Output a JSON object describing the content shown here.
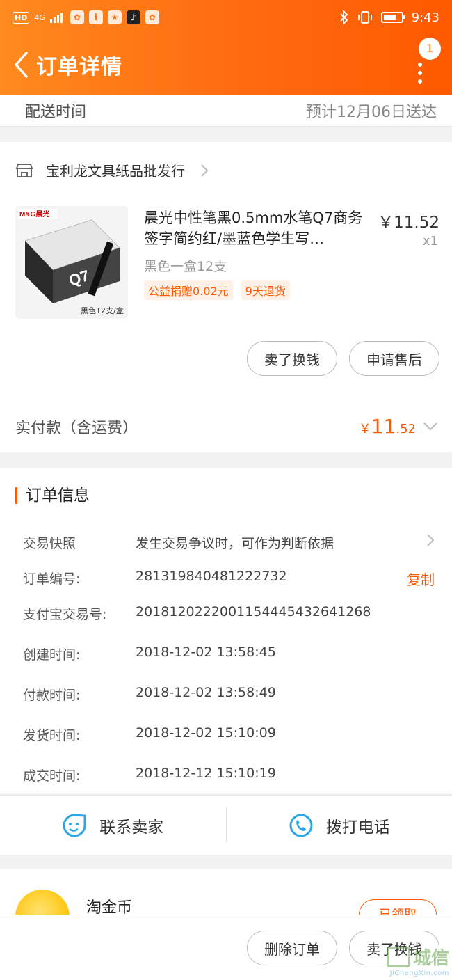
{
  "status_bar": {
    "left_badges": [
      "HD",
      "4G"
    ],
    "app_icons": [
      "paw-icon",
      "i",
      "star-icon",
      "tiktok-icon",
      "paw-icon"
    ],
    "time": "9:43"
  },
  "header": {
    "title": "订单详情",
    "notification_count": "1"
  },
  "delivery": {
    "label": "配送时间",
    "value": "预计12月06日送达"
  },
  "shop": {
    "name": "宝利龙文具纸品批发行"
  },
  "product": {
    "image_caption": "黑色12支/盒",
    "image_brand": "M&G晨光",
    "title": "晨光中性笔黑0.5mm水笔Q7商务签字简约红/墨蓝色学生写…",
    "price": "￥11.52",
    "quantity": "x1",
    "sku": "黑色一盒12支",
    "tags": [
      "公益捐赠0.02元",
      "9天退货"
    ],
    "buttons": {
      "sell": "卖了换钱",
      "after_sale": "申请售后"
    }
  },
  "payment": {
    "label": "实付款（含运费）",
    "currency": "￥",
    "amount_int": "11",
    "amount_dec": ".52"
  },
  "order_info": {
    "title": "订单信息",
    "rows": [
      {
        "label": "交易快照",
        "value": "发生交易争议时，可作为判断依据"
      },
      {
        "label": "订单编号:",
        "value": "281319840481222732",
        "action": "复制"
      },
      {
        "label": "支付宝交易号:",
        "value": "2018120222001154445432641268"
      },
      {
        "label": "创建时间:",
        "value": "2018-12-02 13:58:45"
      },
      {
        "label": "付款时间:",
        "value": "2018-12-02 13:58:49"
      },
      {
        "label": "发货时间:",
        "value": "2018-12-02 15:10:09"
      },
      {
        "label": "成交时间:",
        "value": "2018-12-12 15:10:19"
      }
    ]
  },
  "contact": {
    "seller": "联系卖家",
    "call": "拨打电话"
  },
  "coin": {
    "label": "淘金币",
    "button": "已领取"
  },
  "bottom_bar": {
    "delete": "删除订单",
    "sell": "卖了换钱"
  },
  "watermark": {
    "text": "城信",
    "url": "JiChengXin.com"
  },
  "colors": {
    "accent": "#ff5a00",
    "header_start": "#ff8a1e",
    "header_end": "#ff5a00"
  }
}
